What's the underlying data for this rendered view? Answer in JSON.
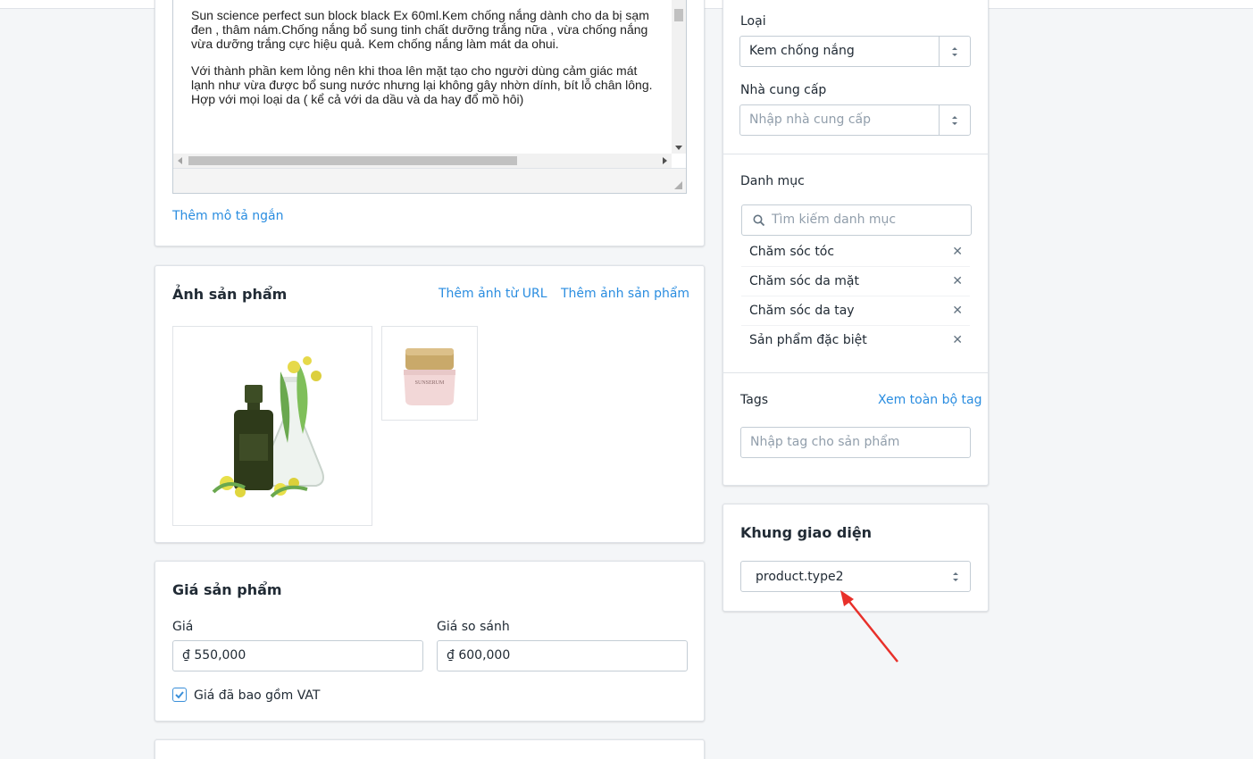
{
  "description": {
    "paragraph1": "Sun science perfect sun block black Ex 60ml.Kem chống nắng dành cho da bị sạm đen , thâm nám.Chống nắng bổ sung tinh chất dưỡng trắng nữa , vừa chống nắng vừa dưỡng trắng cực hiệu quả. Kem chống nắng làm mát da ohui.",
    "paragraph2": "Với thành phần kem lỏng nên khi thoa lên mặt tạo cho người dùng cảm giác mát lạnh như vừa được bổ sung nước nhưng lại không gây nhờn dính, bít lỗ chân lông. Hợp với mọi loại da ( kể cả với da dầu và da hay đổ mồ hôi)",
    "add_short_desc": "Thêm mô tả ngắn"
  },
  "images": {
    "title": "Ảnh sản phẩm",
    "add_from_url": "Thêm ảnh từ URL",
    "add_image": "Thêm ảnh sản phẩm",
    "jar_label": "SUNSERUM"
  },
  "pricing": {
    "title": "Giá sản phẩm",
    "price_label": "Giá",
    "price_value": "₫ 550,000",
    "compare_label": "Giá so sánh",
    "compare_value": "₫ 600,000",
    "vat_label": "Giá đã bao gồm VAT",
    "vat_checked": true
  },
  "organization": {
    "type_label": "Loại",
    "type_value": "Kem chống nắng",
    "vendor_label": "Nhà cung cấp",
    "vendor_placeholder": "Nhập nhà cung cấp",
    "category_label": "Danh mục",
    "category_search_placeholder": "Tìm kiếm danh mục",
    "categories": [
      "Chăm sóc tóc",
      "Chăm sóc da mặt",
      "Chăm sóc da tay",
      "Sản phẩm đặc biệt"
    ],
    "tags_label": "Tags",
    "view_all_tags": "Xem toàn bộ tag",
    "tags_placeholder": "Nhập tag cho sản phẩm"
  },
  "template": {
    "title": "Khung giao diện",
    "value": "product.type2"
  },
  "colors": {
    "link": "#2a8de0",
    "annotation_arrow": "#e8302a",
    "checkbox": "#3a8fd9"
  }
}
